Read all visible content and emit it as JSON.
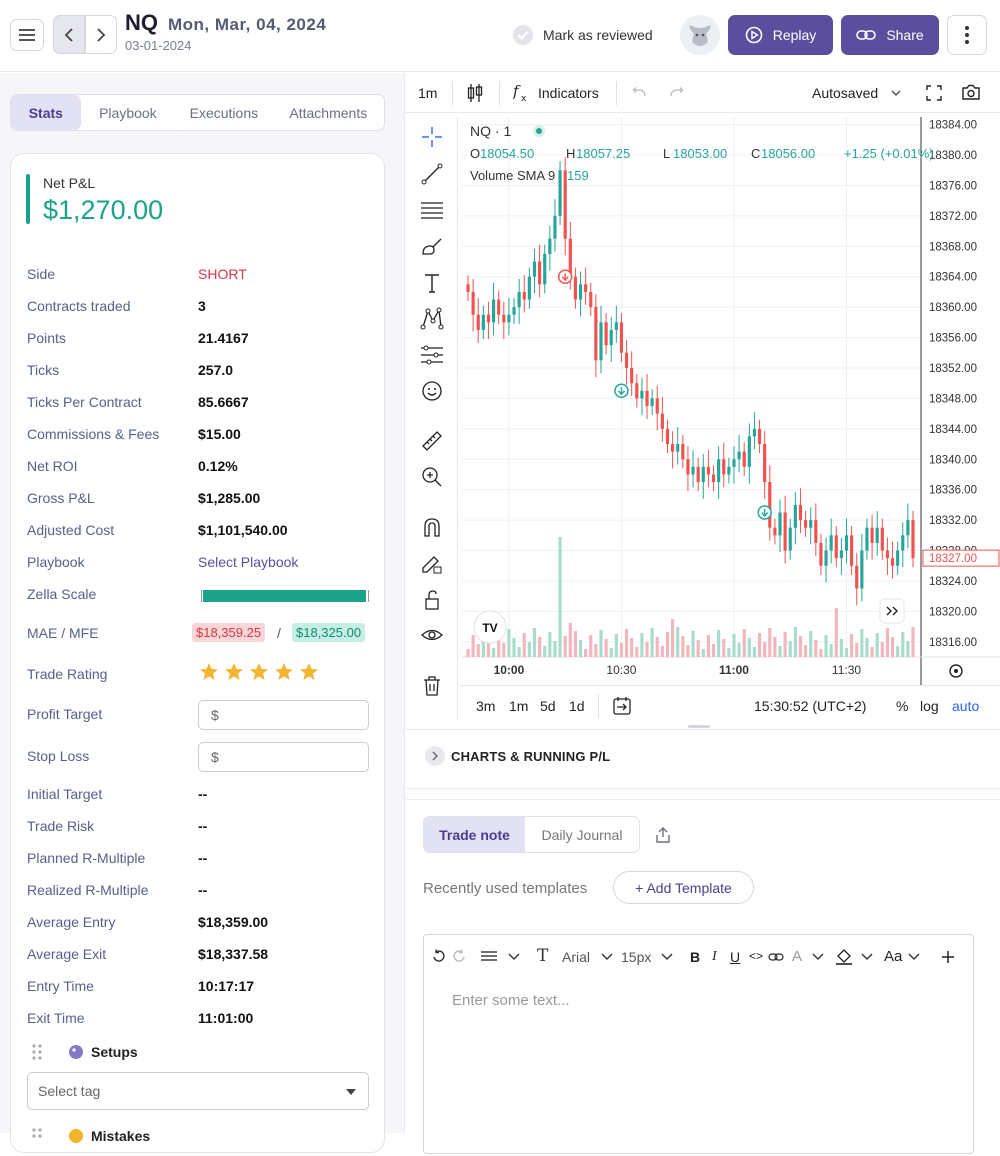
{
  "header": {
    "symbol": "NQ",
    "date": "Mon, Mar, 04, 2024",
    "subdate": "03-01-2024",
    "mark_reviewed": "Mark as reviewed",
    "replay": "Replay",
    "share": "Share"
  },
  "left": {
    "tabs": [
      "Stats",
      "Playbook",
      "Executions",
      "Attachments"
    ],
    "netpl_label": "Net P&L",
    "netpl_value": "$1,270.00",
    "stats": [
      {
        "label": "Side",
        "value": "SHORT"
      },
      {
        "label": "Contracts traded",
        "value": "3"
      },
      {
        "label": "Points",
        "value": "21.4167"
      },
      {
        "label": "Ticks",
        "value": "257.0"
      },
      {
        "label": "Ticks Per Contract",
        "value": "85.6667"
      },
      {
        "label": "Commissions & Fees",
        "value": "$15.00"
      },
      {
        "label": "Net ROI",
        "value": "0.12%"
      },
      {
        "label": "Gross P&L",
        "value": "$1,285.00"
      },
      {
        "label": "Adjusted Cost",
        "value": "$1,101,540.00"
      },
      {
        "label": "Playbook",
        "value": "Select Playbook"
      }
    ],
    "zella_label": "Zella Scale",
    "zella_fraction": 0.98,
    "mae_label": "MAE / MFE",
    "mae_value": "$18,359.25",
    "mfe_value": "$18,325.00",
    "mae_sep": "/",
    "rating_label": "Trade Rating",
    "rating": 5,
    "profit_target_label": "Profit Target",
    "stop_loss_label": "Stop Loss",
    "currency_symbol": "$",
    "stats2": [
      {
        "label": "Initial Target",
        "value": "--"
      },
      {
        "label": "Trade Risk",
        "value": "--"
      },
      {
        "label": "Planned R-Multiple",
        "value": "--"
      },
      {
        "label": "Realized R-Multiple",
        "value": "--"
      },
      {
        "label": "Average Entry",
        "value": "$18,359.00"
      },
      {
        "label": "Average Exit",
        "value": "$18,337.58"
      },
      {
        "label": "Entry Time",
        "value": "10:17:17"
      },
      {
        "label": "Exit Time",
        "value": "11:01:00"
      }
    ],
    "setups_label": "Setups",
    "select_tag": "Select tag",
    "mistakes_label": "Mistakes"
  },
  "chart_toolbar": {
    "interval": "1m",
    "indicators": "Indicators",
    "autosaved": "Autosaved"
  },
  "chart_data": {
    "type": "candlestick",
    "symbol_label": "NQ · 1",
    "ohlc": {
      "o": "18054.50",
      "h": "18057.25",
      "l": "18053.00",
      "c": "18056.00",
      "chg": "+1.25 (+0.01%)"
    },
    "volume_label": "Volume SMA 9",
    "volume_value": "159",
    "y_ticks": [
      "18384.00",
      "18380.00",
      "18376.00",
      "18372.00",
      "18368.00",
      "18364.00",
      "18360.00",
      "18356.00",
      "18352.00",
      "18348.00",
      "18344.00",
      "18340.00",
      "18336.00",
      "18332.00",
      "18328.00",
      "18324.00",
      "18320.00",
      "18316.00"
    ],
    "y_range": [
      18314,
      18385
    ],
    "x_ticks": [
      "10:00",
      "10:30",
      "11:00",
      "11:30"
    ],
    "last_price": "18327.00",
    "closes": [
      18362,
      18359,
      18357,
      18359,
      18358,
      18361,
      18359,
      18358,
      18359,
      18360,
      18362,
      18361,
      18364,
      18366,
      18363,
      18367,
      18369,
      18372,
      18378,
      18369,
      18364,
      18361,
      18363,
      18362,
      18360,
      18353,
      18358,
      18355,
      18357,
      18358,
      18354,
      18352,
      18350,
      18348,
      18349,
      18347,
      18348,
      18346,
      18344,
      18342,
      18341,
      18342,
      18340,
      18338,
      18339,
      18337,
      18339,
      18338,
      18337,
      18340,
      18338,
      18339,
      18340,
      18341,
      18339,
      18343,
      18344,
      18342,
      18337,
      18331,
      18330,
      18333,
      18328,
      18331,
      18334,
      18332,
      18331,
      18332,
      18329,
      18326,
      18328,
      18330,
      18327,
      18328,
      18330,
      18326,
      18323,
      18328,
      18331,
      18329,
      18331,
      18328,
      18327,
      18326,
      18328,
      18330,
      18332,
      18327
    ],
    "markers": [
      {
        "index": 19,
        "price": 18364,
        "type": "sell"
      },
      {
        "index": 30,
        "price": 18349,
        "type": "buy"
      },
      {
        "index": 58,
        "price": 18333,
        "type": "buy"
      }
    ]
  },
  "chart_bottom": {
    "ranges": [
      "3m",
      "1m",
      "5d",
      "1d"
    ],
    "time": "15:30:52 (UTC+2)",
    "pct": "%",
    "log": "log",
    "auto": "auto"
  },
  "charts_running": "CHARTS & RUNNING P/L",
  "notes": {
    "tabs": [
      "Trade note",
      "Daily Journal"
    ],
    "recent_templates": "Recently used templates",
    "add_template": "+ Add Template",
    "font": "Arial",
    "size": "15px",
    "case": "Aa",
    "placeholder": "Enter some text..."
  }
}
